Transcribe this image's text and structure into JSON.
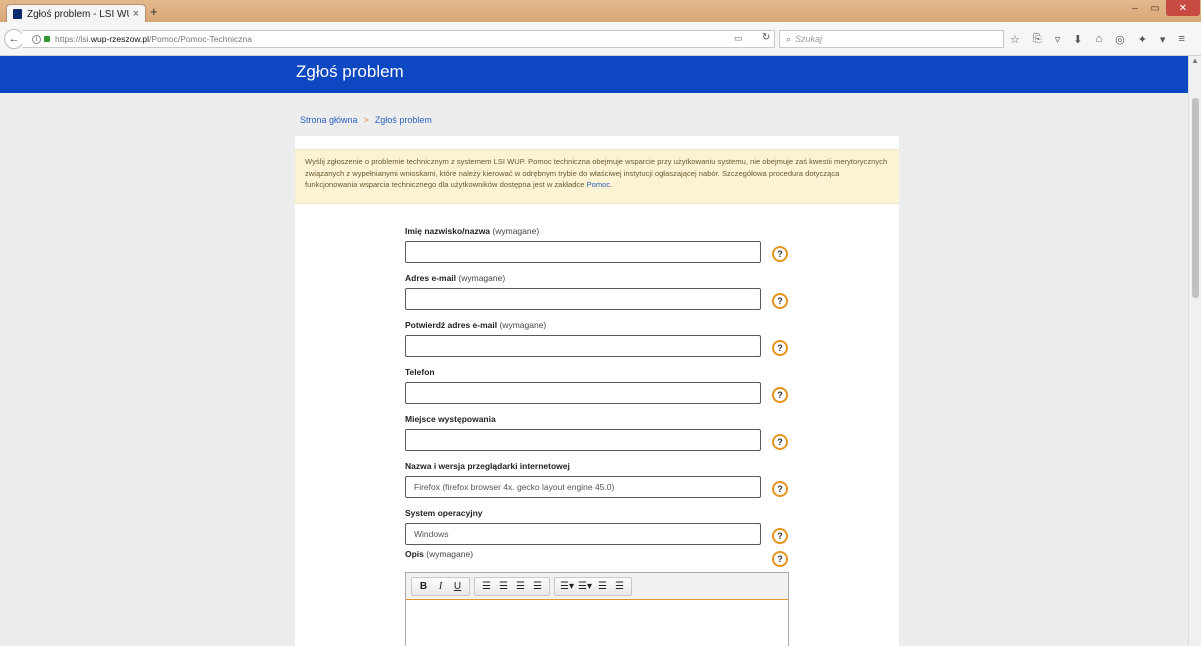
{
  "browser": {
    "tab_title": "Zgłoś problem - LSI WUP ...",
    "tab_close": "×",
    "new_tab": "+",
    "url_prefix": "https://lsi.",
    "url_host": "wup-rzeszow.pl",
    "url_path": "/Pomoc/Pomoc-Techniczna",
    "search_placeholder": "Szukaj",
    "window_min": "–",
    "window_max": "▭",
    "window_close": "✕"
  },
  "page": {
    "header_title": "Zgłoś problem",
    "breadcrumb": {
      "home": "Strona główna",
      "separator": ">",
      "current": "Zgłoś problem"
    },
    "notice": {
      "text": "Wyślij zgłoszenie o problemie technicznym z systemem LSI WUP. Pomoc techniczna obejmuje wsparcie przy użytkowaniu systemu, nie obejmuje zaś kwestii merytorycznych związanych z wypełnianymi wnioskami, które należy kierować w odrębnym trybie do właściwej instytucji ogłaszającej nabór. Szczegółowa procedura dotycząca funkcjonowania wsparcia technicznego dla użytkowników dostępna jest w zakładce ",
      "link": "Pomoc",
      "end": "."
    },
    "required_suffix": " (wymagane)",
    "fields": [
      {
        "label": "Imię nazwisko/nazwa",
        "required": true,
        "value": ""
      },
      {
        "label": "Adres e-mail",
        "required": true,
        "value": ""
      },
      {
        "label": "Potwierdź adres e-mail",
        "required": true,
        "value": ""
      },
      {
        "label": "Telefon",
        "required": false,
        "value": ""
      },
      {
        "label": "Miejsce występowania",
        "required": false,
        "value": ""
      },
      {
        "label": "Nazwa i wersja przeglądarki internetowej",
        "required": false,
        "value": "Firefox (firefox browser 4x. gecko layout engine 45.0)"
      },
      {
        "label": "System operacyjny",
        "required": false,
        "value": "Windows"
      }
    ],
    "description": {
      "label": "Opis",
      "required_text": " (wymagane)"
    },
    "help_icon_text": "?"
  },
  "colors": {
    "header": "#0d47c2",
    "notice_bg": "#fbf3d3",
    "help_ring": "#e5951e",
    "link": "#2a5fbd"
  },
  "icons": [
    "back-arrow-icon",
    "info-icon",
    "lock-icon",
    "reader-view-icon",
    "reload-icon",
    "search-icon",
    "bookmark-star-icon",
    "clipboard-icon",
    "pocket-icon",
    "download-icon",
    "home-icon",
    "chat-icon",
    "extension-icon",
    "menu-icon",
    "help-icon"
  ]
}
